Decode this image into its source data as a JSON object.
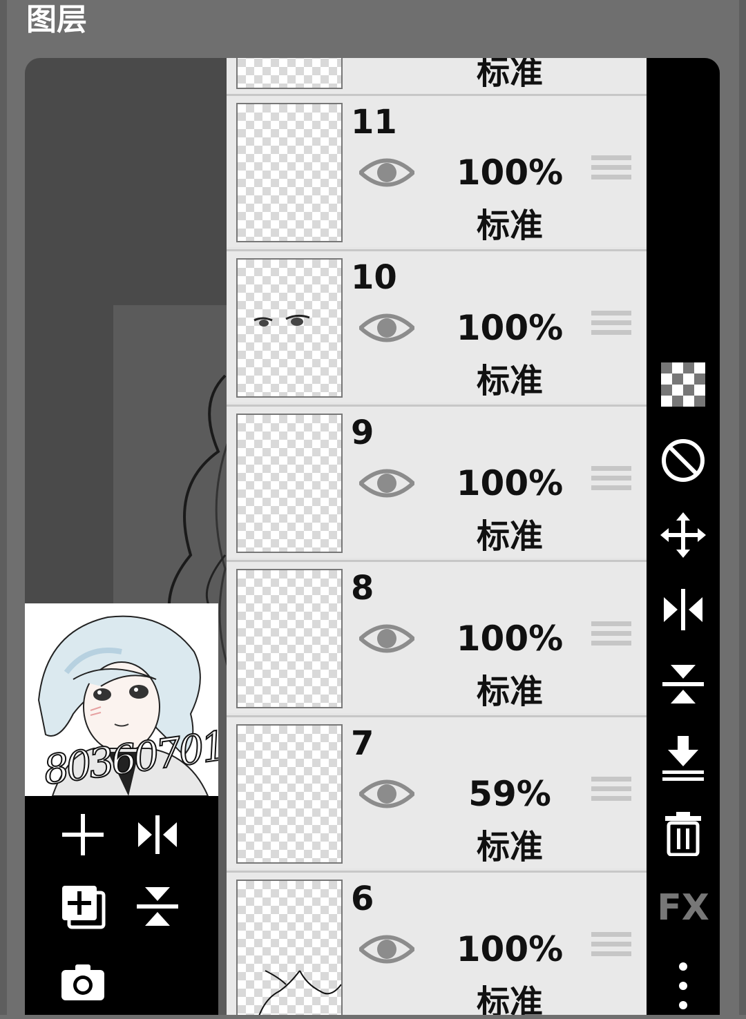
{
  "panel": {
    "title": "图层"
  },
  "preview": {
    "watermark": "80360701"
  },
  "left_toolbar": {
    "buttons": [
      {
        "icon": "plus-icon"
      },
      {
        "icon": "flip-horizontal-icon"
      },
      {
        "icon": "duplicate-layer-icon"
      },
      {
        "icon": "flip-vertical-icon"
      },
      {
        "icon": "camera-icon"
      }
    ]
  },
  "layers": [
    {
      "number": "",
      "opacity": "",
      "blend": "标准"
    },
    {
      "number": "11",
      "opacity": "100%",
      "blend": "标准"
    },
    {
      "number": "10",
      "opacity": "100%",
      "blend": "标准"
    },
    {
      "number": "9",
      "opacity": "100%",
      "blend": "标准"
    },
    {
      "number": "8",
      "opacity": "100%",
      "blend": "标准"
    },
    {
      "number": "7",
      "opacity": "59%",
      "blend": "标准"
    },
    {
      "number": "6",
      "opacity": "100%",
      "blend": "标准"
    }
  ],
  "right_toolbar": {
    "buttons": [
      {
        "icon": "transparency-checker-icon"
      },
      {
        "icon": "invert-circle-icon"
      },
      {
        "icon": "move-arrows-icon"
      },
      {
        "icon": "flip-horizontal-icon"
      },
      {
        "icon": "flip-vertical-icon"
      },
      {
        "icon": "merge-down-icon"
      },
      {
        "icon": "trash-icon"
      },
      {
        "icon": "fx-icon"
      },
      {
        "icon": "more-vertical-icon"
      }
    ],
    "fx_label": "FX"
  }
}
